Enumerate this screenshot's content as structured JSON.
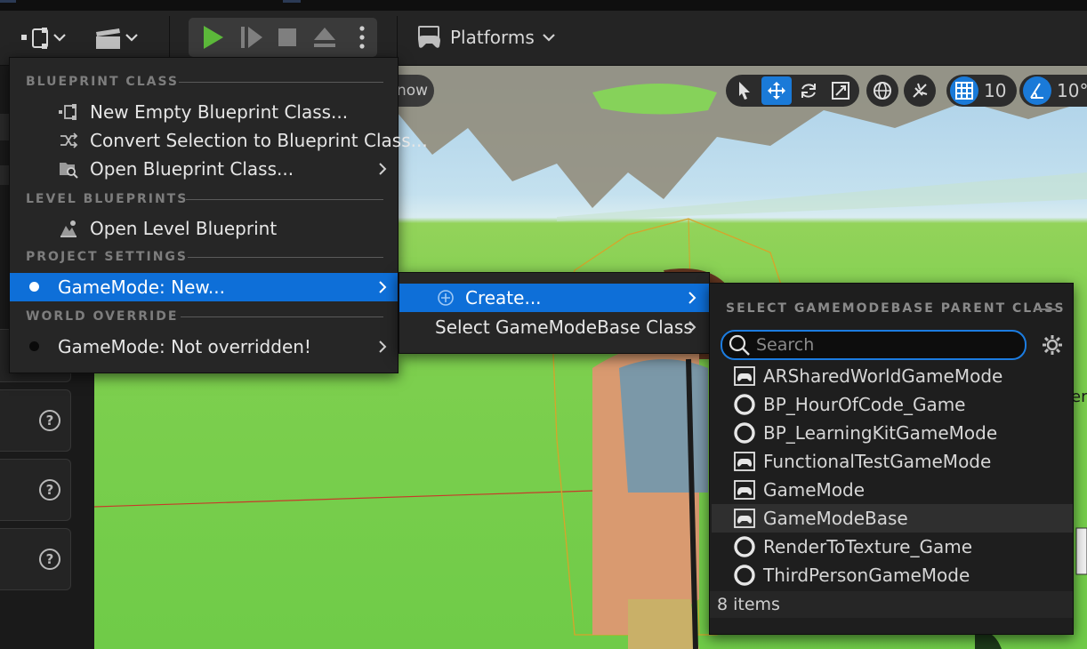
{
  "toolbar": {
    "blueprint_icon": "blueprint-icon",
    "cinematics_icon": "clapperboard-icon",
    "platforms_label": "Platforms",
    "play_controls": [
      "play-icon",
      "step-icon",
      "stop-icon",
      "eject-icon",
      "more-vertical-icon"
    ]
  },
  "viewport": {
    "partial_button_label": "now",
    "grid_snap_value": "10",
    "rotation_snap_value": "10°",
    "edge_text": "er"
  },
  "blueprint_menu": {
    "sections": [
      {
        "header": "BLUEPRINT CLASS"
      },
      {
        "header": "LEVEL BLUEPRINTS"
      },
      {
        "header": "PROJECT SETTINGS"
      },
      {
        "header": "WORLD OVERRIDE"
      }
    ],
    "items": [
      {
        "label": "New Empty Blueprint Class...",
        "icon": "new-blueprint-icon"
      },
      {
        "label": "Convert Selection to Blueprint Class...",
        "icon": "convert-icon"
      },
      {
        "label": "Open Blueprint Class...",
        "icon": "folder-search-icon",
        "submenu": true
      },
      {
        "label": "Open Level Blueprint",
        "icon": "level-blueprint-icon"
      },
      {
        "label": "GameMode: New...",
        "submenu": true,
        "highlighted": true
      },
      {
        "label": "GameMode: Not overridden!",
        "submenu": true
      }
    ]
  },
  "gamemode_submenu": {
    "items": [
      {
        "label": "Create...",
        "icon": "plus-circle-icon",
        "highlighted": true
      },
      {
        "label": "Select GameModeBase Class"
      }
    ]
  },
  "class_picker": {
    "title": "SELECT GAMEMODEBASE PARENT CLASS",
    "search_placeholder": "Search",
    "classes": [
      {
        "name": "ARSharedWorldGameMode",
        "icon": "gamepad-icon"
      },
      {
        "name": "BP_HourOfCode_Game",
        "icon": "blueprint-circle-icon"
      },
      {
        "name": "BP_LearningKitGameMode",
        "icon": "blueprint-circle-icon"
      },
      {
        "name": "FunctionalTestGameMode",
        "icon": "gamepad-icon"
      },
      {
        "name": "GameMode",
        "icon": "gamepad-icon"
      },
      {
        "name": "GameModeBase",
        "icon": "gamepad-icon",
        "selected": true
      },
      {
        "name": "RenderToTexture_Game",
        "icon": "blueprint-circle-icon"
      },
      {
        "name": "ThirdPersonGameMode",
        "icon": "blueprint-circle-icon"
      }
    ],
    "item_count": "8 items"
  },
  "colors": {
    "accent": "#0e6fd8",
    "play_green": "#5cb83a"
  }
}
